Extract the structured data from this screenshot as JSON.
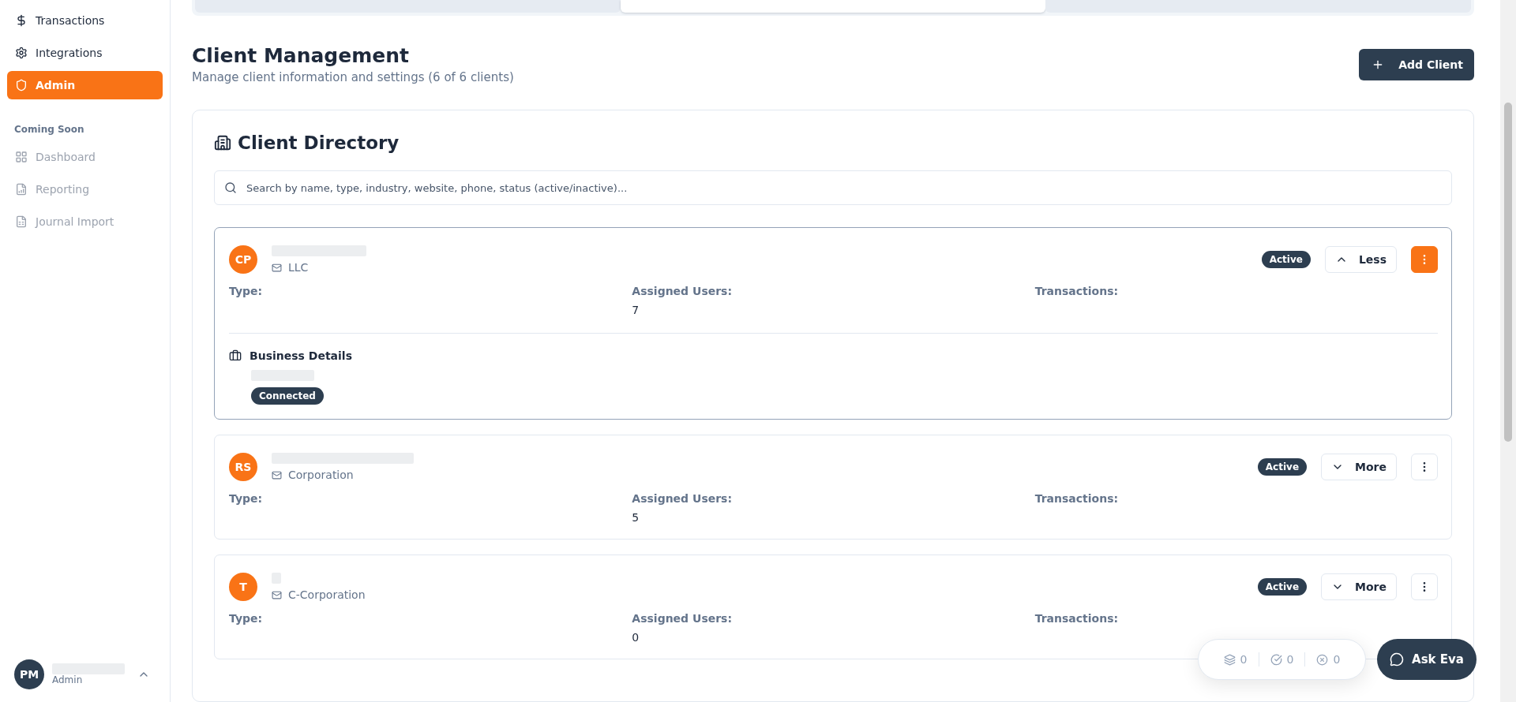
{
  "sidebar": {
    "items": [
      {
        "label": "Transactions",
        "selected": false
      },
      {
        "label": "Integrations",
        "selected": false
      },
      {
        "label": "Admin",
        "selected": true
      }
    ],
    "section_title": "Coming Soon",
    "soon_items": [
      {
        "label": "Dashboard",
        "disabled": true
      },
      {
        "label": "Reporting",
        "disabled": true
      },
      {
        "label": "Journal Import",
        "disabled": true
      }
    ],
    "user": {
      "initials": "PM",
      "role": "Admin"
    }
  },
  "tabs": [
    {
      "selected": false
    },
    {
      "selected": true
    },
    {
      "selected": false
    }
  ],
  "header": {
    "title": "Client Management",
    "subtitle": "Manage client information and settings (6 of 6 clients)",
    "add_button": "Add Client"
  },
  "directory": {
    "title": "Client Directory",
    "search_placeholder": "Search by name, type, industry, website, phone, status (active/inactive)...",
    "clients": [
      {
        "initials": "CP",
        "entity": "LLC",
        "status": "Active",
        "toggle": "Less",
        "expanded": true,
        "menu_selected": true,
        "fields": [
          {
            "label": "Type:"
          },
          {
            "label": "Assigned Users:",
            "value": "7"
          },
          {
            "label": "Transactions:"
          }
        ],
        "details_title": "Business Details",
        "connection": "Connected"
      },
      {
        "initials": "RS",
        "entity": "Corporation",
        "status": "Active",
        "toggle": "More",
        "expanded": false,
        "menu_selected": false,
        "fields": [
          {
            "label": "Type:"
          },
          {
            "label": "Assigned Users:",
            "value": "5"
          },
          {
            "label": "Transactions:"
          }
        ]
      },
      {
        "initials": "T",
        "entity": "C-Corporation",
        "status": "Active",
        "toggle": "More",
        "expanded": false,
        "menu_selected": false,
        "fields": [
          {
            "label": "Type:"
          },
          {
            "label": "Assigned Users:",
            "value": "0"
          },
          {
            "label": "Transactions:"
          }
        ]
      }
    ]
  },
  "status_pill": [
    {
      "kind": "layers",
      "count": "0"
    },
    {
      "kind": "check",
      "count": "0"
    },
    {
      "kind": "cross",
      "count": "0"
    }
  ],
  "chat_button": "Ask Eva"
}
